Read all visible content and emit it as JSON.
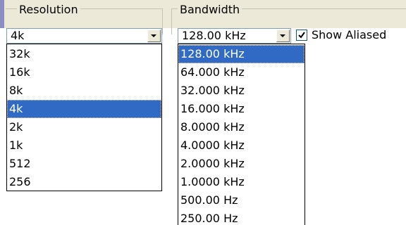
{
  "resolution": {
    "label": "Resolution",
    "selected_value": "4k",
    "options": [
      "32k",
      "16k",
      "8k",
      "4k",
      "2k",
      "1k",
      "512",
      "256"
    ],
    "highlighted_index": 3
  },
  "bandwidth": {
    "label": "Bandwidth",
    "selected_value": "128.00 kHz",
    "options": [
      "128.00 kHz",
      "64.000 kHz",
      "32.000 kHz",
      "16.000 kHz",
      "8.0000 kHz",
      "4.0000 kHz",
      "2.0000 kHz",
      "1.0000 kHz",
      "500.00 Hz",
      "250.00 Hz"
    ],
    "highlighted_index": 0
  },
  "show_aliased": {
    "label": "Show Aliased",
    "checked": true
  },
  "colors": {
    "selection": "#316ac5",
    "panel": "#ece9d8",
    "accent": "#8b8ec4"
  },
  "icons": {
    "dropdown": "chevron-down-icon",
    "check": "checkmark-icon"
  }
}
